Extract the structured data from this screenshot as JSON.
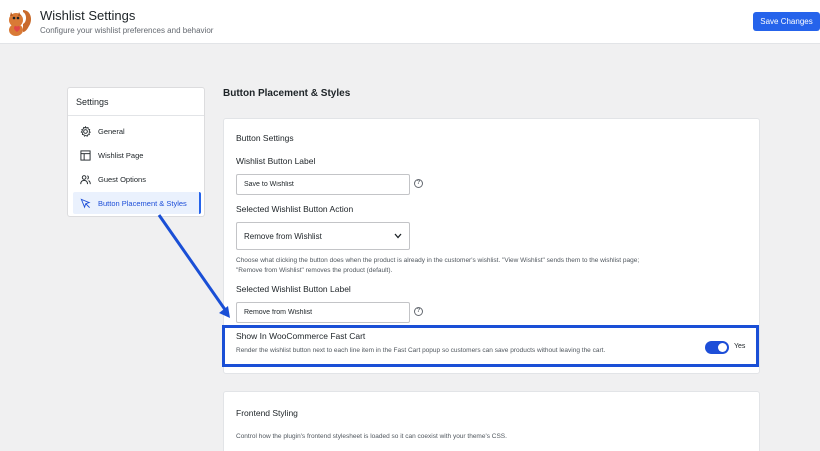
{
  "header": {
    "title": "Wishlist Settings",
    "subtitle": "Configure your wishlist preferences and behavior",
    "save_label": "Save Changes"
  },
  "sidebar": {
    "title": "Settings",
    "items": [
      {
        "label": "General",
        "icon": "gear-icon"
      },
      {
        "label": "Wishlist Page",
        "icon": "layout-icon"
      },
      {
        "label": "Guest Options",
        "icon": "users-icon"
      },
      {
        "label": "Button Placement & Styles",
        "icon": "cursor-icon",
        "active": true
      }
    ]
  },
  "main": {
    "section_heading": "Button Placement & Styles",
    "button_settings": {
      "title": "Button Settings",
      "label_field": {
        "label": "Wishlist Button Label",
        "value": "Save to Wishlist"
      },
      "action_field": {
        "label": "Selected Wishlist Button Action",
        "value": "Remove from Wishlist"
      },
      "action_help_1": "Choose what clicking the button does when the product is already in the customer's wishlist. \"View Wishlist\" sends them to the wishlist page;",
      "action_help_2": "\"Remove from Wishlist\" removes the product (default).",
      "selected_label_field": {
        "label": "Selected Wishlist Button Label",
        "value": "Remove from Wishlist"
      },
      "fast_cart": {
        "label": "Show In WooCommerce Fast Cart",
        "help": "Render the wishlist button next to each line item in the Fast Cart popup so customers can save products without leaving the cart.",
        "toggle_state": "Yes",
        "enabled": true
      }
    },
    "frontend_styling": {
      "title": "Frontend Styling",
      "help": "Control how the plugin's frontend stylesheet is loaded so it can coexist with your theme's CSS."
    }
  },
  "colors": {
    "accent": "#2563eb",
    "highlight_border": "#1a4fd6",
    "background": "#f0f0f1"
  }
}
